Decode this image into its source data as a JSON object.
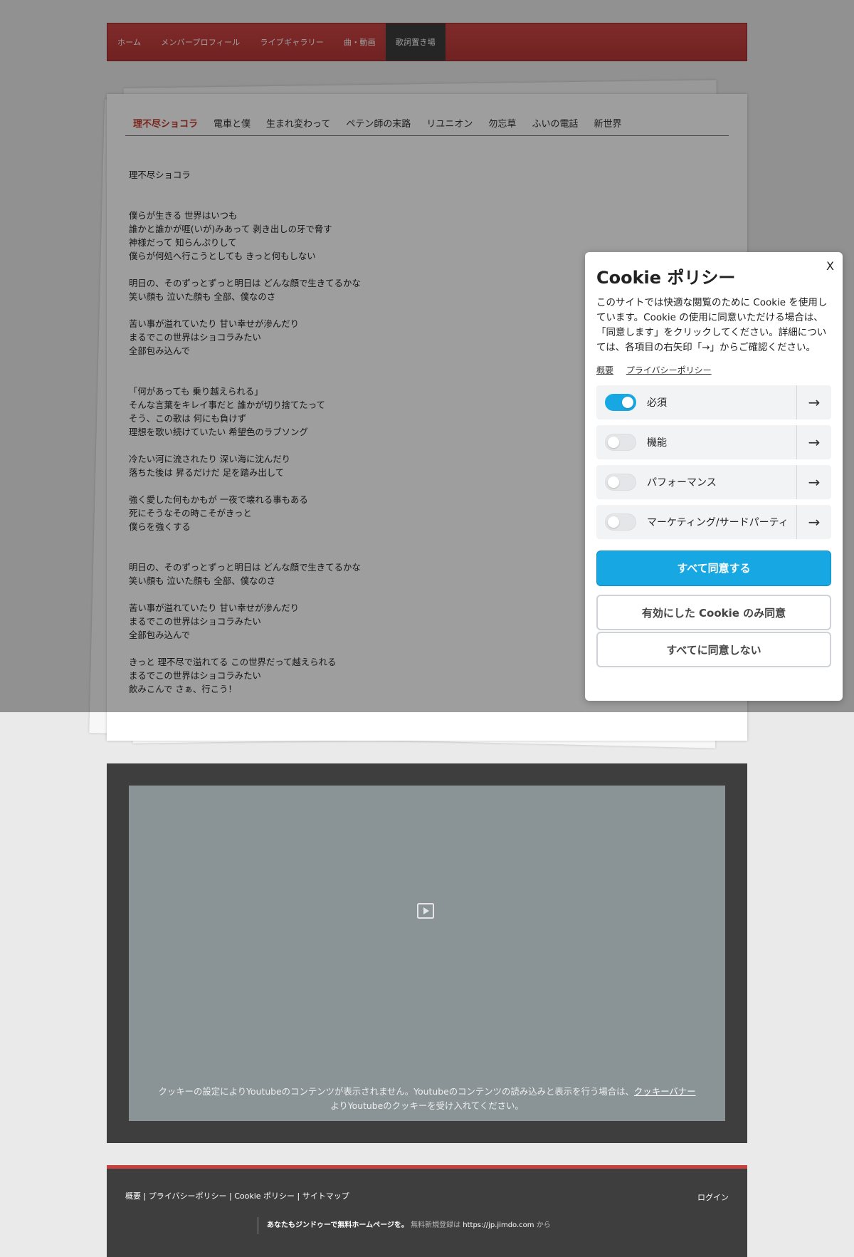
{
  "nav": {
    "items": [
      "ホーム",
      "メンバープロフィール",
      "ライブギャラリー",
      "曲・動画",
      "歌詞置き場"
    ],
    "active_index": 4
  },
  "tabs": {
    "items": [
      "理不尽ショコラ",
      "電車と僕",
      "生まれ変わって",
      "ペテン師の末路",
      "リユニオン",
      "勿忘草",
      "ふいの電話",
      "新世界"
    ],
    "active_index": 0
  },
  "lyrics": {
    "title": "理不尽ショコラ",
    "blocks": [
      {
        "gap": false,
        "lines": [
          "僕らが生きる 世界はいつも",
          "誰かと誰かが啀(いが)みあって 剥き出しの牙で脅す",
          "神様だって 知らんぷりして",
          "僕らが何処へ行こうとしても きっと何もしない"
        ]
      },
      {
        "gap": false,
        "lines": [
          "明日の、そのずっとずっと明日は どんな顔で生きてるかな",
          "笑い顔も 泣いた顔も 全部、僕なのさ"
        ]
      },
      {
        "gap": true,
        "lines": [
          "苦い事が溢れていたり 甘い幸せが滲んだり",
          "まるでこの世界はショコラみたい",
          "全部包み込んで"
        ]
      },
      {
        "gap": false,
        "lines": [
          "「何があっても 乗り越えられる」",
          "そんな言葉をキレイ事だと 誰かが切り捨てたって",
          "そう、この歌は 何にも負けず",
          "理想を歌い続けていたい 希望色のラブソング"
        ]
      },
      {
        "gap": false,
        "lines": [
          "冷たい河に流されたり 深い海に沈んだり",
          "落ちた後は 昇るだけだ 足を踏み出して"
        ]
      },
      {
        "gap": true,
        "lines": [
          "強く愛した何もかもが 一夜で壊れる事もある",
          "死にそうなその時こそがきっと",
          "僕らを強くする"
        ]
      },
      {
        "gap": false,
        "lines": [
          "明日の、そのずっとずっと明日は どんな顔で生きてるかな",
          "笑い顔も 泣いた顔も 全部、僕なのさ"
        ]
      },
      {
        "gap": false,
        "lines": [
          "苦い事が溢れていたり 甘い幸せが滲んだり",
          "まるでこの世界はショコラみたい",
          "全部包み込んで"
        ]
      },
      {
        "gap": false,
        "lines": [
          "きっと 理不尽で溢れてる この世界だって越えられる",
          "まるでこの世界はショコラみたい",
          "飲みこんで さぁ、行こう！"
        ]
      }
    ]
  },
  "video": {
    "note_before": "クッキーの設定によりYoutubeのコンテンツが表示されません。Youtubeのコンテンツの読み込みと表示を行う場合は、",
    "note_link": "クッキーバナー",
    "note_after": "よりYoutubeのクッキーを受け入れてください。",
    "icon": "play-icon"
  },
  "footer": {
    "links": [
      "概要",
      "プライバシーポリシー",
      "Cookie ポリシー",
      "サイトマップ"
    ],
    "separator": " | ",
    "login": "ログイン",
    "promo_bold": "あなたもジンドゥーで無料ホームページを。",
    "promo_text": " 無料新規登録は ",
    "promo_url": "https://jp.jimdo.com",
    "promo_suffix": " から"
  },
  "cookie": {
    "close_label": "X",
    "title": "Cookie ポリシー",
    "text": "このサイトでは快適な閲覧のために Cookie を使用しています。Cookie の使用に同意いただける場合は、「同意します」をクリックしてください。詳細については、各項目の右矢印「→」からご確認ください。",
    "links": [
      "概要",
      "プライバシーポリシー"
    ],
    "categories": [
      {
        "label": "必須",
        "enabled": true
      },
      {
        "label": "機能",
        "enabled": false
      },
      {
        "label": "パフォーマンス",
        "enabled": false
      },
      {
        "label": "マーケティング/サードパーティ",
        "enabled": false
      }
    ],
    "arrow": "→",
    "accept_all": "すべて同意する",
    "accept_selected": "有効にした Cookie のみ同意",
    "reject_all": "すべてに同意しない",
    "accent_color": "#17a8e3"
  }
}
